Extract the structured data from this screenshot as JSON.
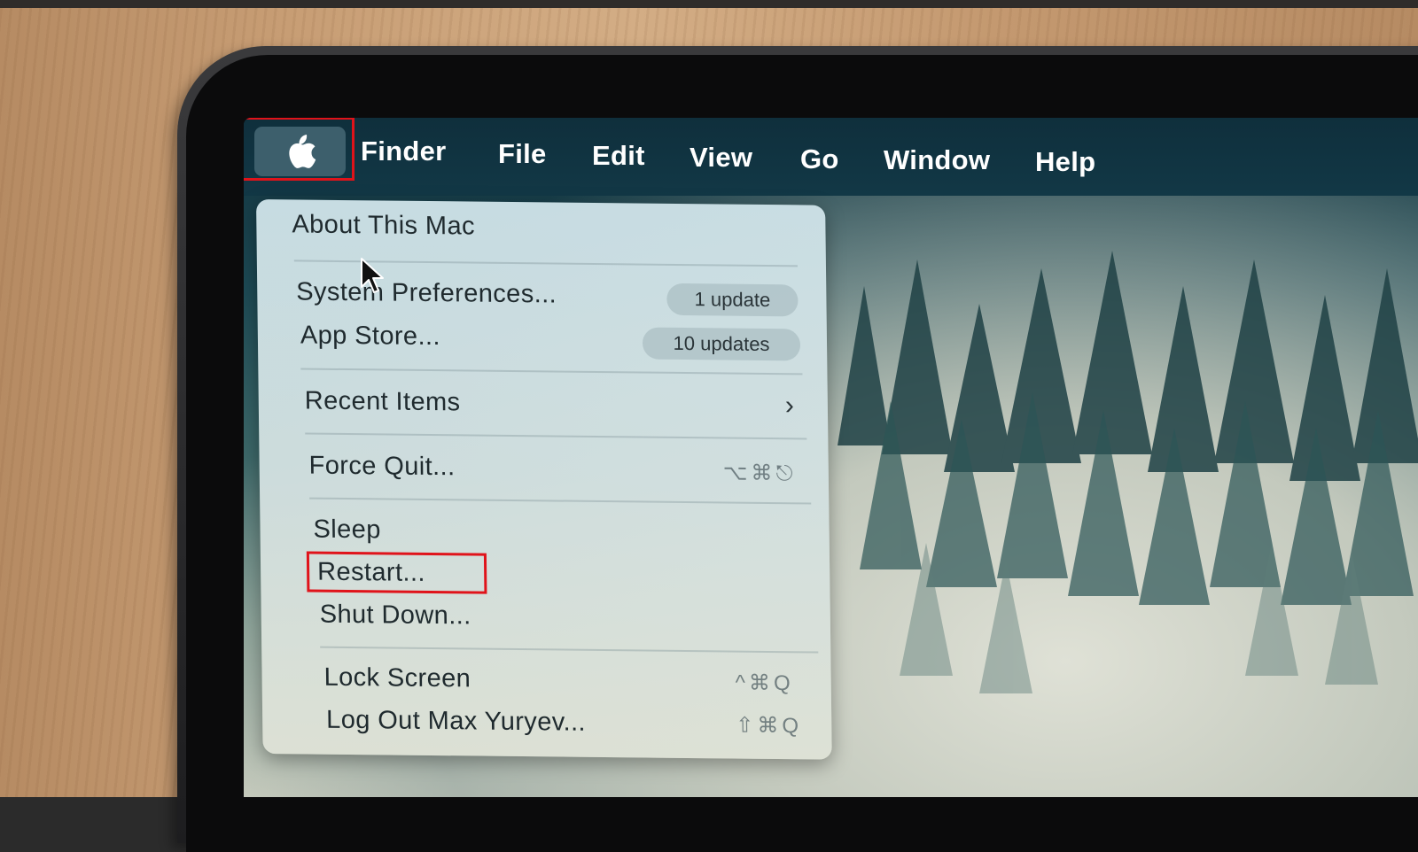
{
  "menubar": {
    "apple_icon": "apple-logo-icon",
    "items": [
      "Finder",
      "File",
      "Edit",
      "View",
      "Go",
      "Window",
      "Help"
    ]
  },
  "apple_menu": {
    "about": "About This Mac",
    "system_preferences": {
      "label": "System Preferences...",
      "badge": "1 update"
    },
    "app_store": {
      "label": "App Store...",
      "badge": "10 updates"
    },
    "recent_items": {
      "label": "Recent Items",
      "icon": "chevron-right-icon"
    },
    "force_quit": {
      "label": "Force Quit...",
      "shortcut": "⌥⌘⎋"
    },
    "sleep": "Sleep",
    "restart": "Restart...",
    "shut_down": "Shut Down...",
    "lock_screen": {
      "label": "Lock Screen",
      "shortcut": "^⌘Q"
    },
    "log_out": {
      "label": "Log Out Max Yuryev...",
      "shortcut": "⇧⌘Q"
    }
  },
  "colors": {
    "highlight": "#e0131a",
    "menubar": "#123846",
    "menu_bg": "#d2e0e0"
  }
}
